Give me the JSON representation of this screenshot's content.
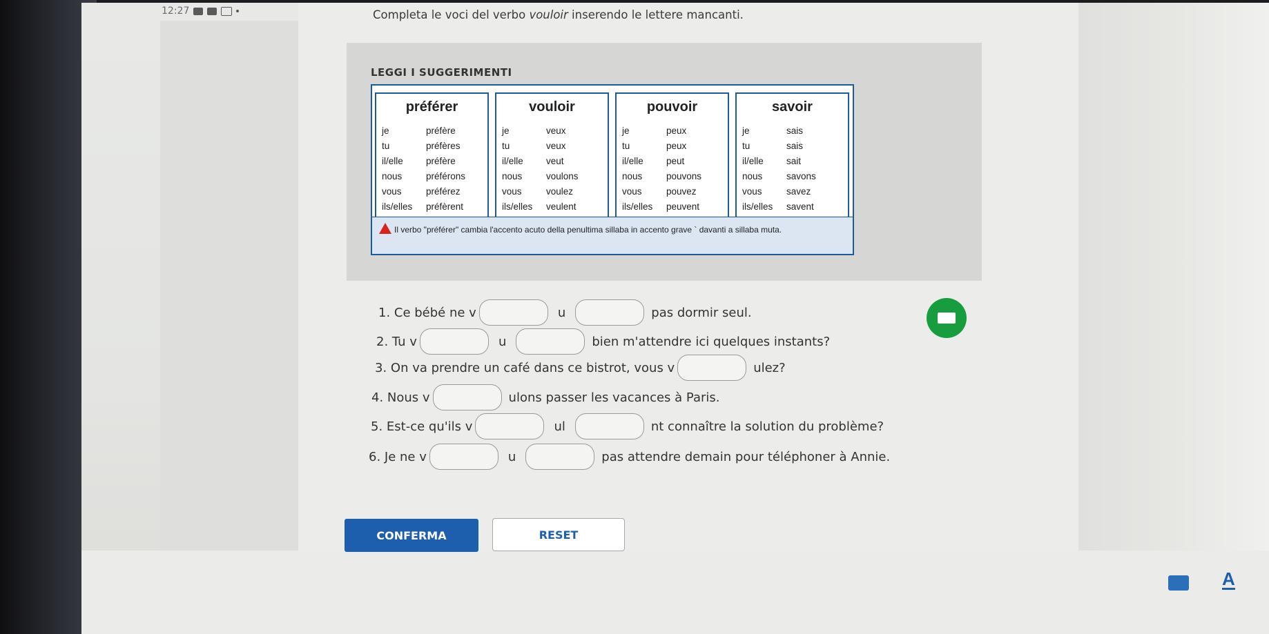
{
  "status": {
    "time": "12:27"
  },
  "instruction": {
    "prefix": "Completa le voci del verbo ",
    "verb": "vouloir",
    "suffix": " inserendo le lettere mancanti."
  },
  "tips": {
    "title": "LEGGI I SUGGERIMENTI",
    "verbs": [
      {
        "name": "préférer",
        "rows": [
          [
            "je",
            "préfère"
          ],
          [
            "tu",
            "préfères"
          ],
          [
            "il/elle",
            "préfère"
          ],
          [
            "nous",
            "préférons"
          ],
          [
            "vous",
            "préférez"
          ],
          [
            "ils/elles",
            "préfèrent"
          ]
        ]
      },
      {
        "name": "vouloir",
        "rows": [
          [
            "je",
            "veux"
          ],
          [
            "tu",
            "veux"
          ],
          [
            "il/elle",
            "veut"
          ],
          [
            "nous",
            "voulons"
          ],
          [
            "vous",
            "voulez"
          ],
          [
            "ils/elles",
            "veulent"
          ]
        ]
      },
      {
        "name": "pouvoir",
        "rows": [
          [
            "je",
            "peux"
          ],
          [
            "tu",
            "peux"
          ],
          [
            "il/elle",
            "peut"
          ],
          [
            "nous",
            "pouvons"
          ],
          [
            "vous",
            "pouvez"
          ],
          [
            "ils/elles",
            "peuvent"
          ]
        ]
      },
      {
        "name": "savoir",
        "rows": [
          [
            "je",
            "sais"
          ],
          [
            "tu",
            "sais"
          ],
          [
            "il/elle",
            "sait"
          ],
          [
            "nous",
            "savons"
          ],
          [
            "vous",
            "savez"
          ],
          [
            "ils/elles",
            "savent"
          ]
        ]
      }
    ],
    "note": "Il verbo \"préférer\" cambia l'accento acuto della penultima sillaba in accento grave ` davanti a sillaba muta."
  },
  "exercises": [
    {
      "before": "1. Ce bébé ne v",
      "mid": "u",
      "after": "pas dormir seul."
    },
    {
      "before": "2. Tu v",
      "mid": "u",
      "after": "bien m'attendre ici quelques instants?"
    },
    {
      "before": "3. On va prendre un café dans ce bistrot, vous v",
      "after": "ulez?"
    },
    {
      "before": "4. Nous v",
      "after": "ulons passer les vacances à Paris."
    },
    {
      "before": "5. Est-ce qu'ils v",
      "mid": "ul",
      "after": "nt connaître la solution du problème?"
    },
    {
      "before": "6. Je ne v",
      "mid": "u",
      "after": "pas attendre demain pour téléphoner à Annie."
    }
  ],
  "buttons": {
    "confirm": "CONFERMA",
    "reset": "RESET"
  },
  "icons": {
    "keyboard": "keyboard-icon",
    "font": "A"
  },
  "colors": {
    "accent": "#1e5fad",
    "fab": "#179c3e",
    "warning": "#d9221c"
  }
}
